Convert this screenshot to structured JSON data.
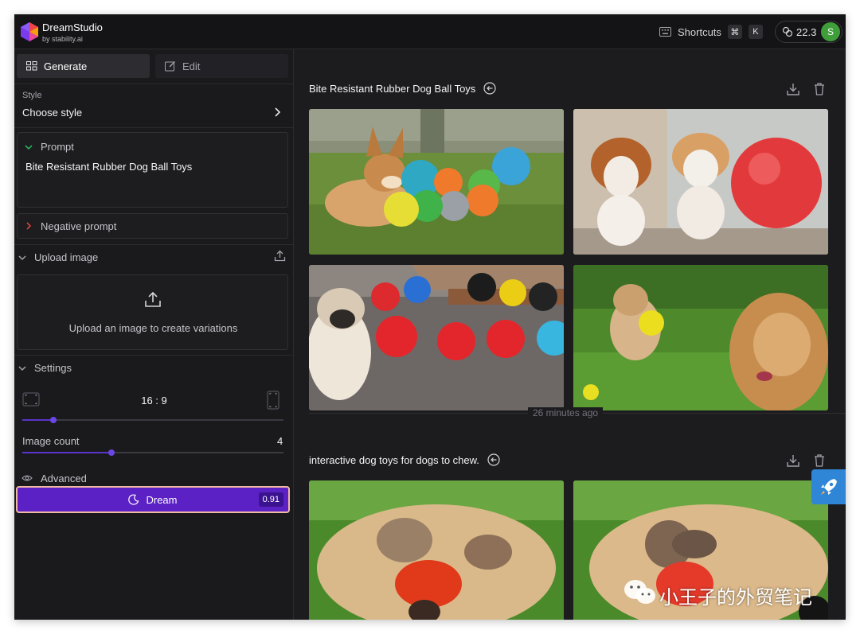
{
  "app": {
    "name": "DreamStudio",
    "byline": "by stability.ai"
  },
  "header": {
    "shortcuts_label": "Shortcuts",
    "shortcut_keys": [
      "⌘",
      "K"
    ],
    "credits": "22.3",
    "avatar_letter": "S"
  },
  "tabs": {
    "generate": "Generate",
    "edit": "Edit"
  },
  "style": {
    "label": "Style",
    "value": "Choose style"
  },
  "prompt": {
    "label": "Prompt",
    "value": "Bite Resistant Rubber Dog Ball Toys"
  },
  "negative_prompt": {
    "label": "Negative prompt"
  },
  "upload": {
    "label": "Upload image",
    "hint": "Upload an image to create variations"
  },
  "settings": {
    "label": "Settings",
    "aspect_ratio": "16 : 9",
    "aspect_slider_fraction": 0.12,
    "image_count_label": "Image count",
    "image_count": "4",
    "image_count_slider_fraction": 0.34,
    "advanced_label": "Advanced"
  },
  "dream": {
    "label": "Dream",
    "cost": "0.91"
  },
  "results": [
    {
      "title": "Bite Resistant Rubber Dog Ball Toys"
    },
    {
      "title": "interactive dog toys for dogs to chew."
    }
  ],
  "timestamp": "26 minutes ago",
  "watermark": "小王子的外贸笔记",
  "colors": {
    "accent": "#5b21c4",
    "avatar": "#3f9e3a",
    "background": "#1c1c1f"
  }
}
